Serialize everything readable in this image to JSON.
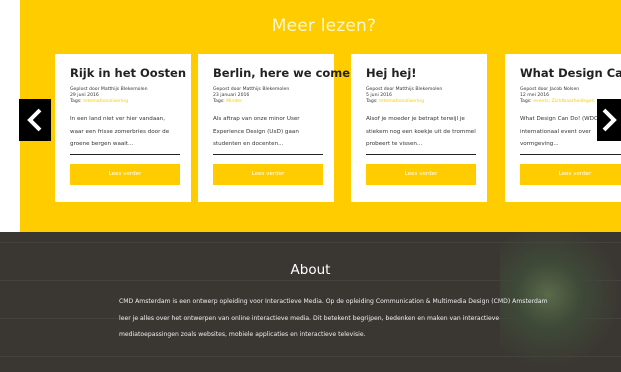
{
  "section_heading": "Meer lezen?",
  "cards": [
    {
      "title": "Rijk in het Oosten",
      "author": "Geplost door Matthijs Blekemolen",
      "date": "29 juni 2016",
      "tags_label": "Tags:",
      "tags": "Internationalisering",
      "excerpt": "In een land niet ver hier vandaan, waar een frisse zomerbries door de groene bergen waait...",
      "button": "Lees verder"
    },
    {
      "title": "Berlin, here we come!",
      "author": "Gepost door Matthijs Blekemolen",
      "date": "23 januari 2016",
      "tags_label": "Tags:",
      "tags": "Minder",
      "excerpt": "Als aftrap van onze minor User Experience Design (UxD) gaan studenten en docenten...",
      "button": "Lees verder"
    },
    {
      "title": "Hej hej!",
      "author": "Gepost door Matthijs Blekemolen",
      "date": "5 juni 2016",
      "tags_label": "Tags:",
      "tags": "Internationalisering",
      "excerpt": "Alsof je moeder je betrapt terwijl je stiekem nog een koekje uit de trommel probeert te vissen...",
      "button": "Lees verder"
    },
    {
      "title": "What Design Can Do!",
      "author": "Gepost door Jacob Nolsen",
      "date": "12 mei 2016",
      "tags_label": "Tags:",
      "tags": "events, Zichtbaarheidsgen",
      "excerpt": "What Design Can Do! (WDCD) is een internationaal event over vormgeving...",
      "button": "Lees verder"
    }
  ],
  "about": {
    "title": "About",
    "text": "CMD Amsterdam is een ontwerp opleiding voor Interactieve Media. Op de opleiding Communication & Multimedia Design (CMD) Amsterdam leer je alles over het ontwerpen van online interactieve media. Dit betekent begrijpen, bedenken en maken van interactieve mediatoepassingen zoals websites, mobiele applicaties en interactieve televisie."
  },
  "icons": {
    "prev": "chevron-left-icon",
    "next": "chevron-right-icon"
  },
  "colors": {
    "accent": "#FFCC00",
    "dark": "#3a3632",
    "arrow_bg": "#000000"
  }
}
